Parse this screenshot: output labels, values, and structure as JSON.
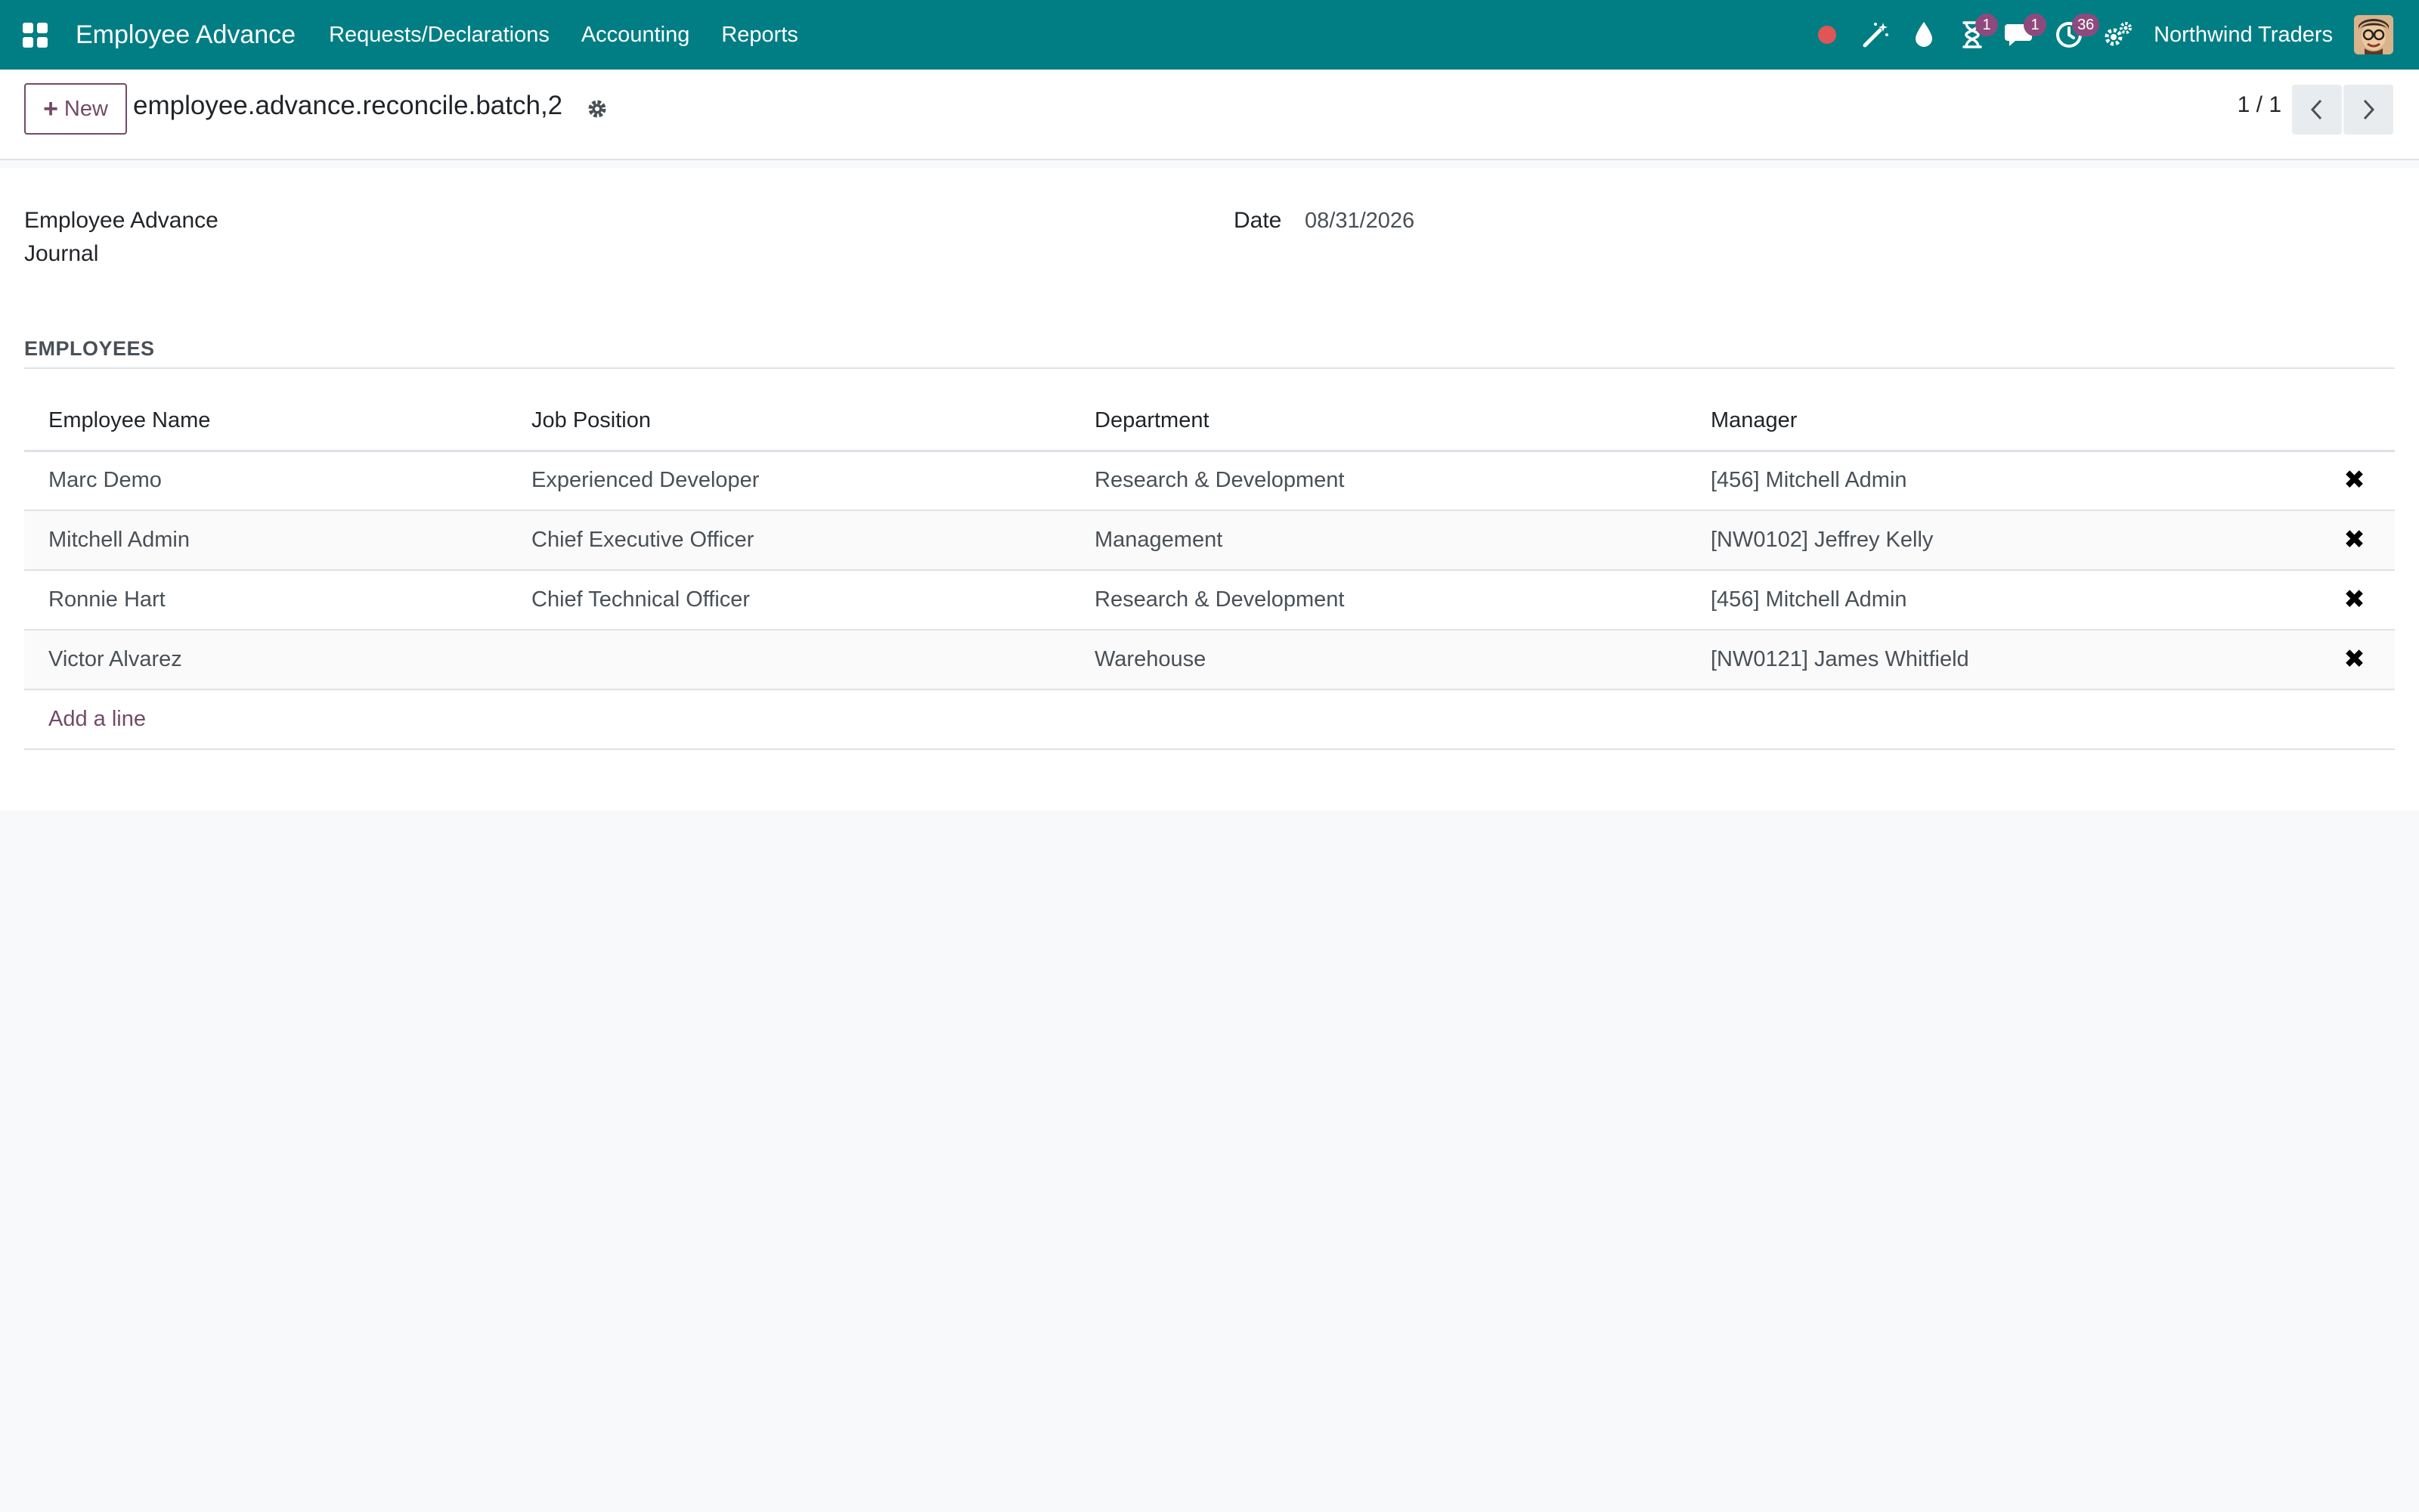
{
  "navbar": {
    "brand": "Employee Advance",
    "menus": [
      "Requests/Declarations",
      "Accounting",
      "Reports"
    ],
    "badges": {
      "activity": "1",
      "messages": "1",
      "timer": "36"
    },
    "company": "Northwind Traders",
    "colors": {
      "bar": "#017e84",
      "badge": "#8e4a7d",
      "recording": "#e05555"
    }
  },
  "control_panel": {
    "new_button": "New",
    "record_title": "employee.advance.reconcile.batch,2",
    "pager": "1 / 1"
  },
  "form": {
    "journal_label": "Employee Advance Journal",
    "date_label": "Date",
    "date_value": "08/31/2026",
    "section_title": "EMPLOYEES"
  },
  "table": {
    "columns": [
      "Employee Name",
      "Job Position",
      "Department",
      "Manager"
    ],
    "rows": [
      {
        "name": "Marc Demo",
        "job": "Experienced Developer",
        "department": "Research & Development",
        "manager": "[456] Mitchell Admin"
      },
      {
        "name": "Mitchell Admin",
        "job": "Chief Executive Officer",
        "department": "Management",
        "manager": "[NW0102] Jeffrey Kelly"
      },
      {
        "name": "Ronnie Hart",
        "job": "Chief Technical Officer",
        "department": "Research & Development",
        "manager": "[456] Mitchell Admin"
      },
      {
        "name": "Victor Alvarez",
        "job": "",
        "department": "Warehouse",
        "manager": "[NW0121] James Whitfield"
      }
    ],
    "add_line": "Add a line",
    "accent": "#714b67"
  }
}
